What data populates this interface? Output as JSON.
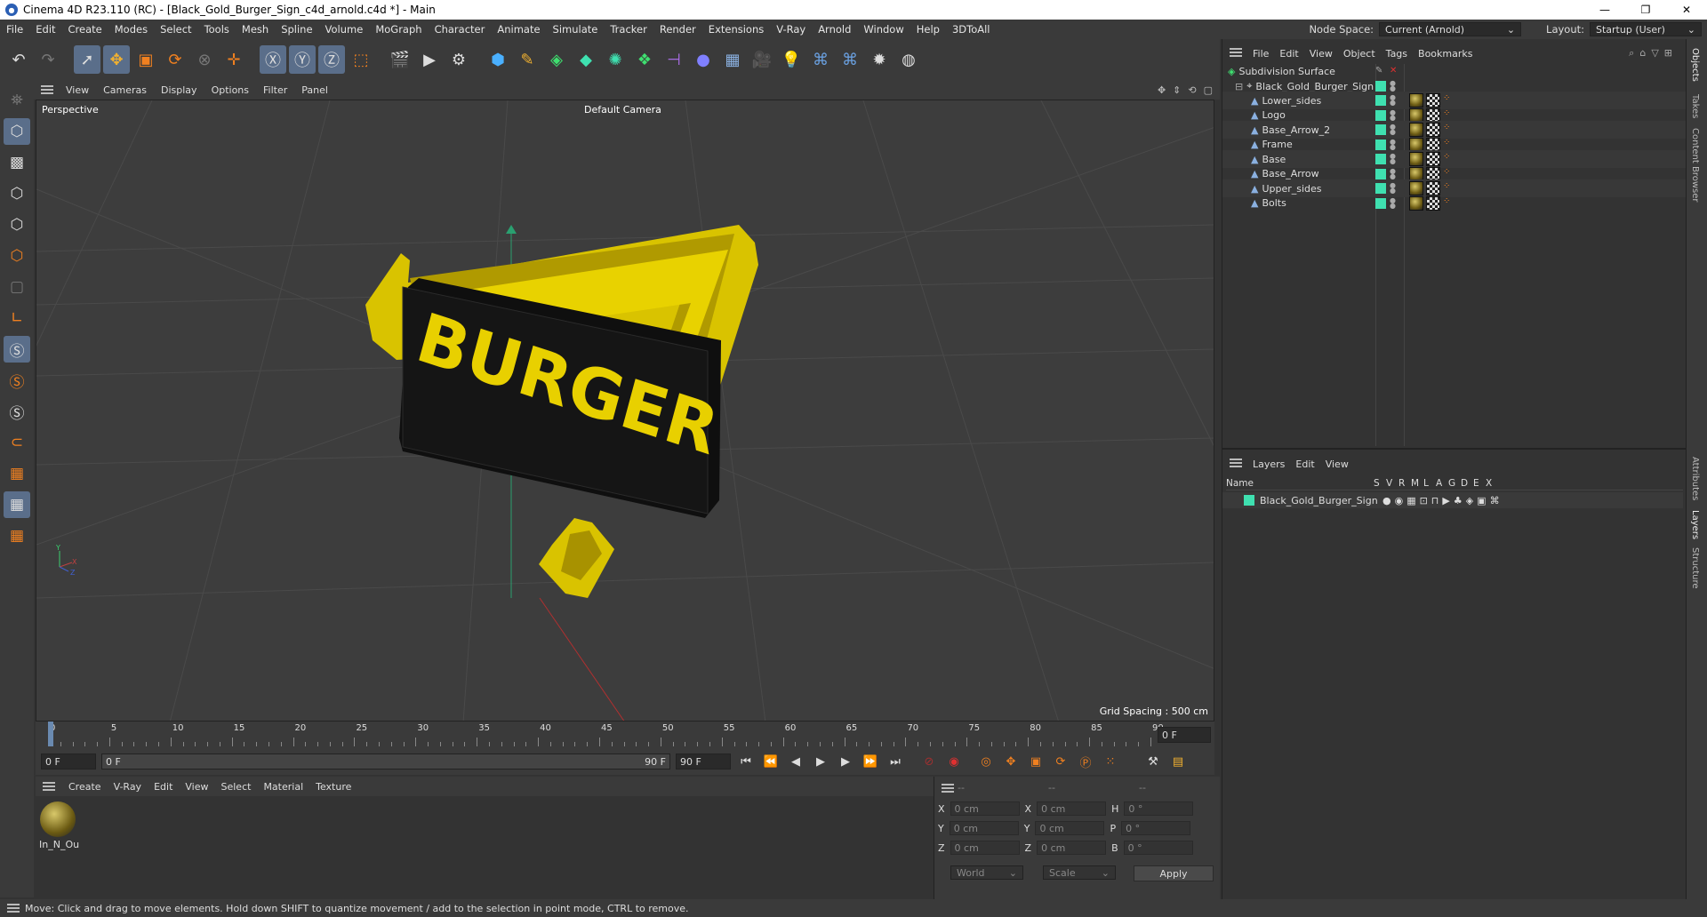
{
  "window": {
    "title": "Cinema 4D R23.110 (RC) - [Black_Gold_Burger_Sign_c4d_arnold.c4d *] - Main",
    "controls": [
      "—",
      "❐",
      "✕"
    ]
  },
  "menubar": {
    "items": [
      "File",
      "Edit",
      "Create",
      "Modes",
      "Select",
      "Tools",
      "Mesh",
      "Spline",
      "Volume",
      "MoGraph",
      "Character",
      "Animate",
      "Simulate",
      "Tracker",
      "Render",
      "Extensions",
      "V-Ray",
      "Arnold",
      "Window",
      "Help",
      "3DToAll"
    ],
    "node_space_label": "Node Space:",
    "node_space_value": "Current (Arnold)",
    "layout_label": "Layout:",
    "layout_value": "Startup (User)"
  },
  "viewport": {
    "menu": [
      "View",
      "Cameras",
      "Display",
      "Options",
      "Filter",
      "Panel"
    ],
    "label": "Perspective",
    "camera": "Default Camera",
    "grid_spacing": "Grid Spacing : 500 cm",
    "sign_text": "BURGER"
  },
  "timeline": {
    "ticks": [
      "0",
      "5",
      "10",
      "15",
      "20",
      "25",
      "30",
      "35",
      "40",
      "45",
      "50",
      "55",
      "60",
      "65",
      "70",
      "75",
      "80",
      "85",
      "90"
    ],
    "current_frame": "0 F"
  },
  "time_controls": {
    "start": "0 F",
    "range_start": "0 F",
    "range_end": "90 F",
    "end": "90 F"
  },
  "material_manager": {
    "menu": [
      "Create",
      "V-Ray",
      "Edit",
      "View",
      "Select",
      "Material",
      "Texture"
    ],
    "material_name": "In_N_Ou"
  },
  "coordinates": {
    "header": [
      "--",
      "--",
      "--"
    ],
    "rows": [
      {
        "a": "X",
        "av": "0 cm",
        "b": "X",
        "bv": "0 cm",
        "c": "H",
        "cv": "0 °"
      },
      {
        "a": "Y",
        "av": "0 cm",
        "b": "Y",
        "bv": "0 cm",
        "c": "P",
        "cv": "0 °"
      },
      {
        "a": "Z",
        "av": "0 cm",
        "b": "Z",
        "bv": "0 cm",
        "c": "B",
        "cv": "0 °"
      }
    ],
    "world": "World",
    "scale": "Scale",
    "apply": "Apply"
  },
  "object_manager": {
    "menu": [
      "File",
      "Edit",
      "View",
      "Object",
      "Tags",
      "Bookmarks"
    ],
    "root": "Subdivision Surface",
    "group": "Black_Gold_Burger_Sign",
    "children": [
      "Lower_sides",
      "Logo",
      "Base_Arrow_2",
      "Frame",
      "Base",
      "Base_Arrow",
      "Upper_sides",
      "Bolts"
    ]
  },
  "layer_manager": {
    "menu": [
      "Layers",
      "Edit",
      "View"
    ],
    "columns": [
      "Name",
      "S",
      "V",
      "R",
      "M",
      "L",
      "A",
      "G",
      "D",
      "E",
      "X"
    ],
    "layer": "Black_Gold_Burger_Sign"
  },
  "side_tabs": [
    "Objects",
    "Takes",
    "Content Browser",
    "Attributes",
    "Layers",
    "Structure"
  ],
  "status": "Move: Click and drag to move elements. Hold down SHIFT to quantize movement / add to the selection in point mode, CTRL to remove.",
  "colors": {
    "accent": "#3fe0b0",
    "sign_gold": "#d9c300",
    "sign_black": "#111111"
  }
}
